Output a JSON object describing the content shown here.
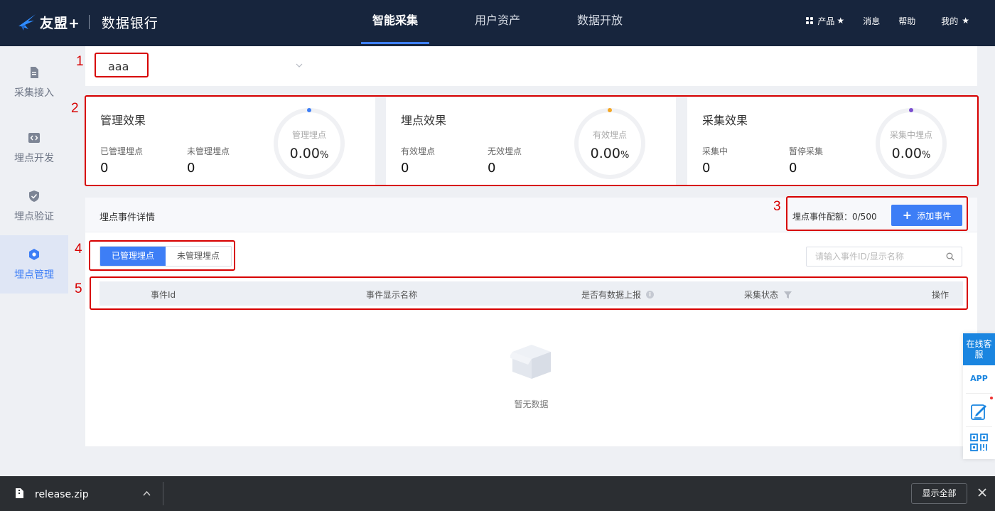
{
  "colors": {
    "nav_bg": "#17253d",
    "accent": "#3d7ef6",
    "annotation_red": "#d70000",
    "ring_blue": "#3d7ef6",
    "ring_orange": "#f5a623",
    "ring_purple": "#7b4fd0"
  },
  "header": {
    "logo_text": "友盟+",
    "logo_icon": "umeng-swallow-icon",
    "product_name": "数据银行",
    "nav_tabs": [
      {
        "label": "智能采集",
        "active": true
      },
      {
        "label": "用户资产",
        "active": false
      },
      {
        "label": "数据开放",
        "active": false
      }
    ],
    "right": {
      "products": "产品",
      "messages": "消息",
      "help": "帮助",
      "mine": "我的",
      "star": "★"
    }
  },
  "sidebar": {
    "items": [
      {
        "label": "采集接入",
        "icon": "document-icon",
        "active": false
      },
      {
        "label": "埋点开发",
        "icon": "code-icon",
        "active": false
      },
      {
        "label": "埋点验证",
        "icon": "shield-check-icon",
        "active": false
      },
      {
        "label": "埋点管理",
        "icon": "hexagon-icon",
        "active": true
      }
    ]
  },
  "app_selector": {
    "value": "aaa"
  },
  "stats": [
    {
      "title": "管理效果",
      "label_a": "已管理埋点",
      "value_a": "0",
      "label_b": "未管理埋点",
      "value_b": "0",
      "ring_label": "管理埋点",
      "ring_value": "0.00",
      "ring_unit": "%"
    },
    {
      "title": "埋点效果",
      "label_a": "有效埋点",
      "value_a": "0",
      "label_b": "无效埋点",
      "value_b": "0",
      "ring_label": "有效埋点",
      "ring_value": "0.00",
      "ring_unit": "%"
    },
    {
      "title": "采集效果",
      "label_a": "采集中",
      "value_a": "0",
      "label_b": "暂停采集",
      "value_b": "0",
      "ring_label": "采集中埋点",
      "ring_value": "0.00",
      "ring_unit": "%"
    }
  ],
  "events": {
    "title": "埋点事件详情",
    "quota": "埋点事件配额：0/500",
    "add_button": "添加事件",
    "tabs": [
      "已管理埋点",
      "未管理埋点"
    ],
    "search_placeholder": "请输入事件ID/显示名称",
    "columns": [
      "事件Id",
      "事件显示名称",
      "是否有数据上报",
      "采集状态",
      "操作"
    ],
    "empty_text": "暂无数据"
  },
  "annotations": [
    "1",
    "2",
    "3",
    "4",
    "5"
  ],
  "float_widget": {
    "customer_service": "在线客服",
    "app": "APP"
  },
  "download_bar": {
    "filename": "release.zip",
    "show_all": "显示全部"
  }
}
